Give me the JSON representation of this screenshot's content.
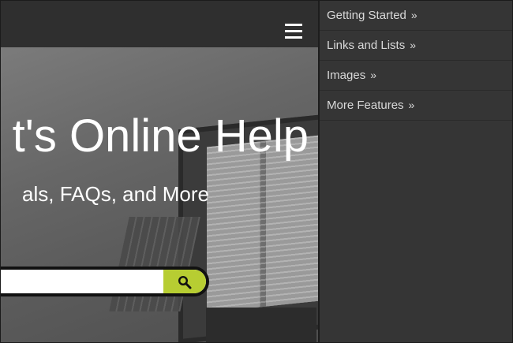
{
  "hero": {
    "title": "t's Online Help",
    "subtitle": "als, FAQs, and More"
  },
  "search": {
    "value": "",
    "button_icon": "search-icon"
  },
  "header": {
    "menu_icon": "hamburger-menu-icon"
  },
  "menu": {
    "items": [
      {
        "label": "Getting Started",
        "arrow": "»"
      },
      {
        "label": "Links and Lists",
        "arrow": "»"
      },
      {
        "label": "Images",
        "arrow": "»"
      },
      {
        "label": "More Features",
        "arrow": "»"
      }
    ]
  },
  "colors": {
    "menu_bg": "#353535",
    "topbar_bg": "#2f2f2f",
    "search_button": "#b7cd32"
  }
}
